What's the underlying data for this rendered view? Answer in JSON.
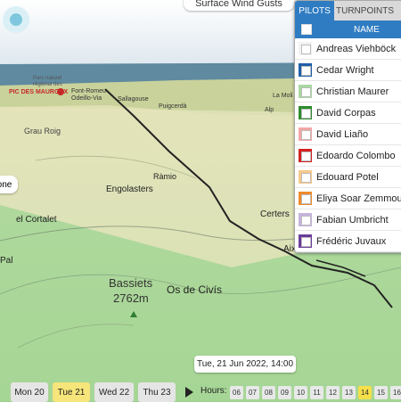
{
  "map": {
    "wind_label": "Surface Wind Gusts",
    "places": {
      "pic_des_mauroux": "PIC DES MAUROUX",
      "grau_roig": "Grau Roig",
      "ramio": "Ràmio",
      "engolasters": "Engolasters",
      "el_cortalet": "el Cortalet",
      "certers": "Certers",
      "aixas": "Aixàs",
      "pal": "Pal",
      "bassiets": "Bassiets",
      "bassiets_elev": "2762m",
      "os_de_civis": "Os de Civís",
      "sallagouse": "Sallagouse",
      "puigcerda": "Puigcerdà",
      "font_romeu": "Font-Romeu",
      "odeillo_via": "Odeillo-Via",
      "parc_naturel": "Parc naturel",
      "regional_des": "régional des",
      "alp": "Alp",
      "la_molina": "La Moli"
    },
    "zone_button": "one",
    "time_label": "Tue, 21 Jun 2022, 14:00"
  },
  "panel": {
    "tabs": [
      "PILOTS",
      "TURNPOINTS"
    ],
    "header": "NAME",
    "pilots": [
      {
        "name": "Andreas Viehböck",
        "color": "#f2f2f2"
      },
      {
        "name": "Cedar Wright",
        "color": "#1f5fa8"
      },
      {
        "name": "Christian Maurer",
        "color": "#a8d8a0"
      },
      {
        "name": "David Corpas",
        "color": "#2e8b2e"
      },
      {
        "name": "David Liaño",
        "color": "#f4a6a6"
      },
      {
        "name": "Edoardo Colombo",
        "color": "#d42020"
      },
      {
        "name": "Edouard Potel",
        "color": "#f7c98a"
      },
      {
        "name": "Eliya Soar Zemmour",
        "color": "#ef8a2a"
      },
      {
        "name": "Fabian Umbricht",
        "color": "#c6b3de"
      },
      {
        "name": "Frédéric Juvaux",
        "color": "#6a3d9a"
      }
    ]
  },
  "bottom": {
    "days": [
      {
        "label": "Mon 20",
        "selected": false
      },
      {
        "label": "Tue 21",
        "selected": true
      },
      {
        "label": "Wed 22",
        "selected": false
      },
      {
        "label": "Thu 23",
        "selected": false
      }
    ],
    "hours_label": "Hours:",
    "hours": [
      "06",
      "07",
      "08",
      "09",
      "10",
      "11",
      "12",
      "13",
      "14",
      "15",
      "16"
    ],
    "selected_hour": "14"
  }
}
